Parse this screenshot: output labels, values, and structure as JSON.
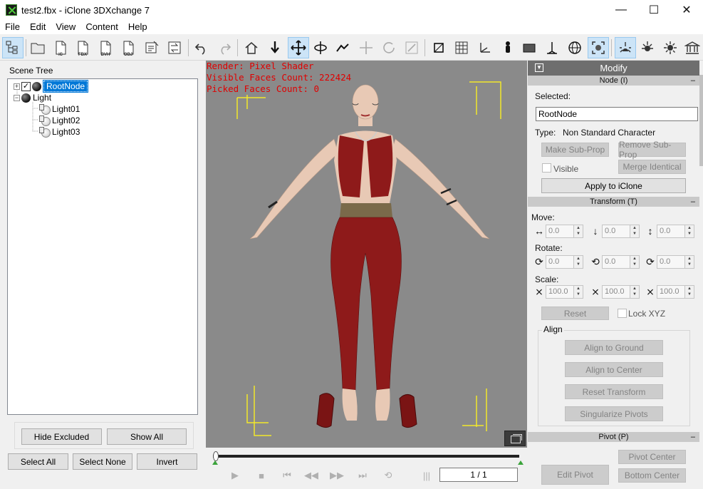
{
  "window": {
    "title": "test2.fbx - iClone 3DXchange 7",
    "min": "—",
    "max": "☐",
    "close": "✕"
  },
  "menu": [
    "File",
    "Edit",
    "View",
    "Content",
    "Help"
  ],
  "toolbar": {
    "labels": {
      "ic": "iC",
      "fbx": "FBX",
      "bvh": "BVH",
      "obj": "OBJ"
    }
  },
  "scene_tree": {
    "label": "Scene Tree",
    "root": "RootNode",
    "light": "Light",
    "lights": [
      "Light01",
      "Light02",
      "Light03"
    ],
    "expand_collapsed": "+",
    "expand_open": "−",
    "check": "✓"
  },
  "left_buttons": {
    "hide_excluded": "Hide Excluded",
    "show_all": "Show All",
    "select_all": "Select All",
    "select_none": "Select None",
    "invert": "Invert"
  },
  "viewport": {
    "render": "Render: Pixel Shader",
    "visible_faces": "Visible Faces Count: 222424",
    "picked_faces": "Picked Faces Count: 0"
  },
  "timeline": {
    "frame": "1 / 1",
    "start_marker": "0",
    "buttons": {
      "play": "▶",
      "stop": "■",
      "first": "⏮",
      "prev": "◀◀",
      "next": "▶▶",
      "last": "⏭",
      "loop": "⟲",
      "bars": "|||"
    }
  },
  "modify": {
    "title": "Modify",
    "node_section": "Node (I)",
    "collapse": "–",
    "selected_label": "Selected:",
    "selected_value": "RootNode",
    "type_label": "Type:",
    "type_value": "Non Standard Character",
    "make_subprop": "Make Sub-Prop",
    "remove_subprop": "Remove Sub-Prop",
    "visible": "Visible",
    "merge_identical": "Merge Identical",
    "apply_to_iclone": "Apply to iClone",
    "transform_section": "Transform (T)",
    "move_label": "Move:",
    "move": [
      "0.0",
      "0.0",
      "0.0"
    ],
    "rotate_label": "Rotate:",
    "rotate": [
      "0.0",
      "0.0",
      "0.0"
    ],
    "scale_label": "Scale:",
    "scale": [
      "100.0",
      "100.0",
      "100.0"
    ],
    "reset": "Reset",
    "lock_xyz": "Lock XYZ",
    "align_label": "Align",
    "align_to_ground": "Align to Ground",
    "align_to_center": "Align to Center",
    "reset_transform": "Reset Transform",
    "singularize_pivots": "Singularize Pivots",
    "pivot_section": "Pivot (P)",
    "edit_pivot": "Edit Pivot",
    "pivot_center": "Pivot Center",
    "bottom_center": "Bottom Center",
    "spin_up": "▲",
    "spin_down": "▼"
  },
  "colors": {
    "viewport_bg": "#8a8a8a",
    "info_text": "#e00000",
    "selection": "#0078d7",
    "outfit_red": "#8e1a1a",
    "skin": "#e8c9b5",
    "belt": "#7a6a4a",
    "guides": "#f2e82a"
  }
}
